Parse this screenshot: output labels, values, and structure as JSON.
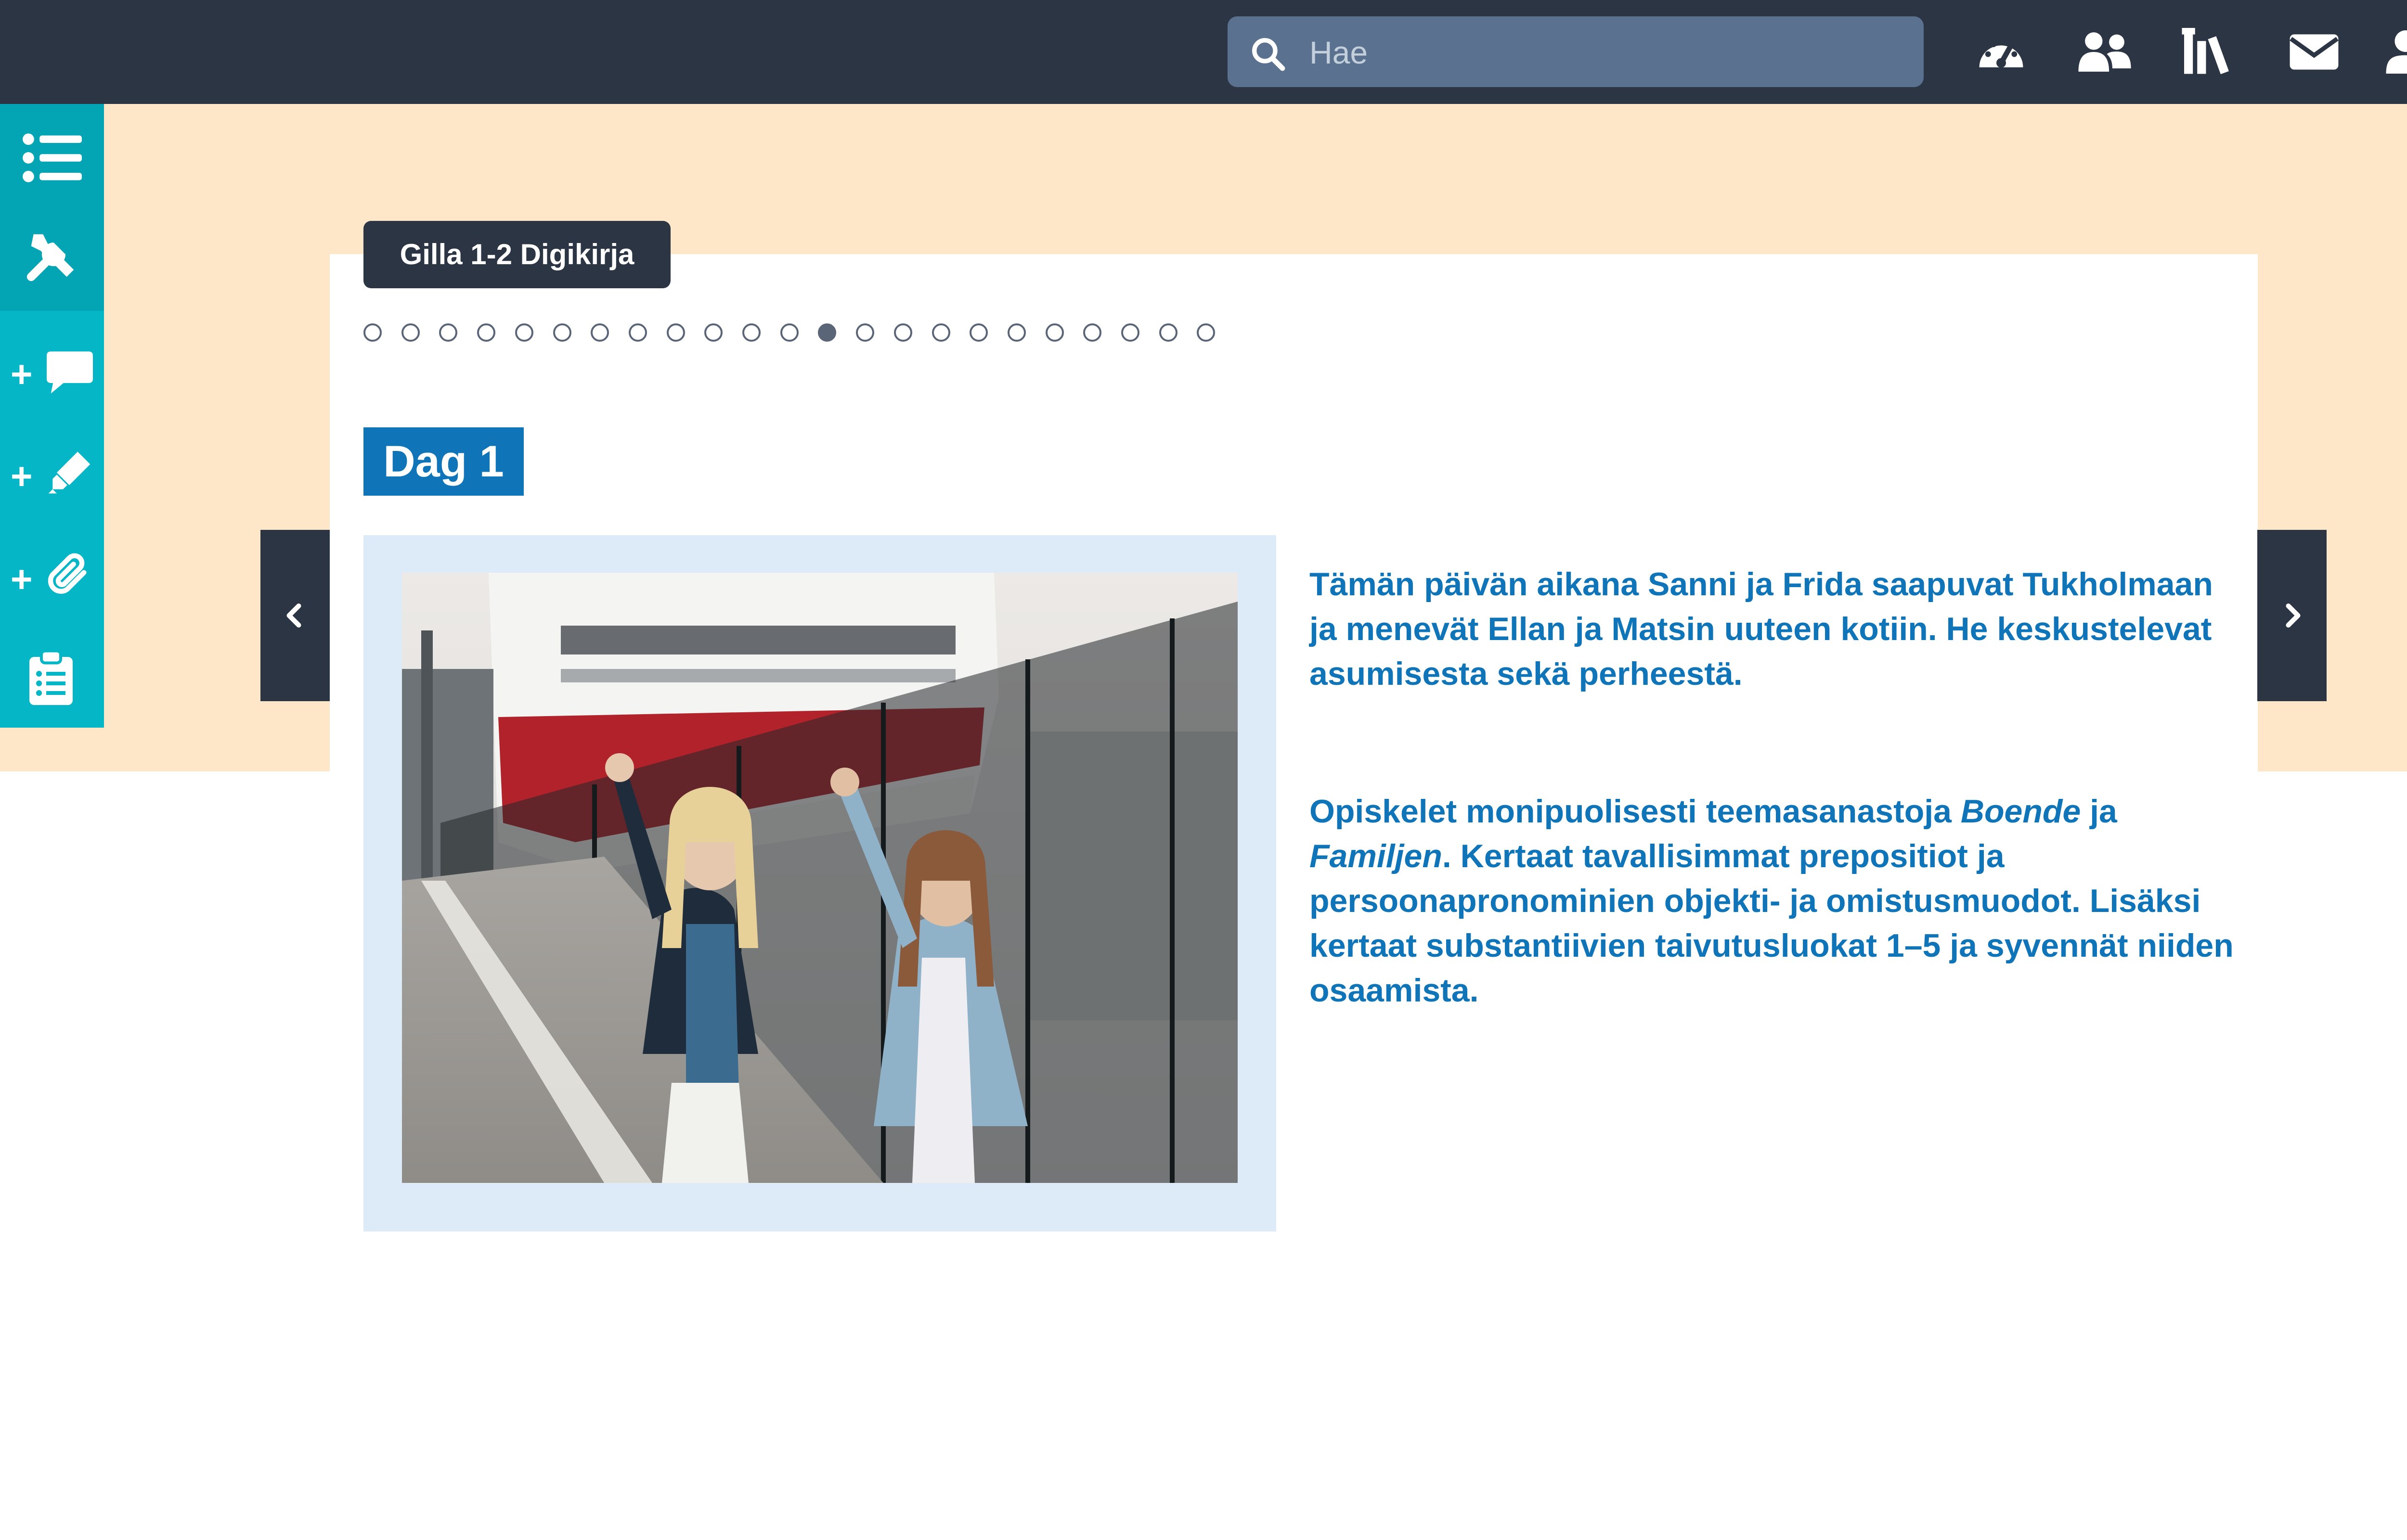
{
  "search": {
    "placeholder": "Hae"
  },
  "top_icons": [
    {
      "name": "dashboard-icon"
    },
    {
      "name": "users-icon"
    },
    {
      "name": "library-icon"
    },
    {
      "name": "mail-icon"
    },
    {
      "name": "user-icon"
    }
  ],
  "sidebar": {
    "items": [
      {
        "name": "list-icon"
      },
      {
        "name": "tools-icon"
      },
      {
        "name": "add-comment-icon",
        "plus": "+"
      },
      {
        "name": "add-highlight-icon",
        "plus": "+"
      },
      {
        "name": "add-attachment-icon",
        "plus": "+"
      },
      {
        "name": "clipboard-icon"
      }
    ]
  },
  "book": {
    "title": "Gilla 1-2 Digikirja"
  },
  "pagination": {
    "total": 23,
    "active_index": 12
  },
  "lesson": {
    "title": "Dag 1",
    "paragraph1": "Tämän päivän aikana Sanni ja Frida saapuvat Tukholmaan ja menevät Ellan ja Matsin uuteen kotiin. He keskustelevat asumisesta sekä perheestä.",
    "p2_start": "Opiskelet monipuolisesti teemasanastoja ",
    "p2_term1": "Boende",
    "p2_and": " ja ",
    "p2_term2": "Familjen",
    "p2_rest": ". Kertaat tavallisimmat prepositiot ja persoonapronominien objekti- ja omistusmuodot. Lisäksi kertaat substantiivien taivutusluokat 1–5 ja syvennät niiden osaamista."
  },
  "colors": {
    "topbar": "#2b3544",
    "sidebar": "#05b6c6",
    "banner": "#fee6c9",
    "accent_blue": "#0f75b8",
    "photo_frame": "#dcebf7"
  }
}
